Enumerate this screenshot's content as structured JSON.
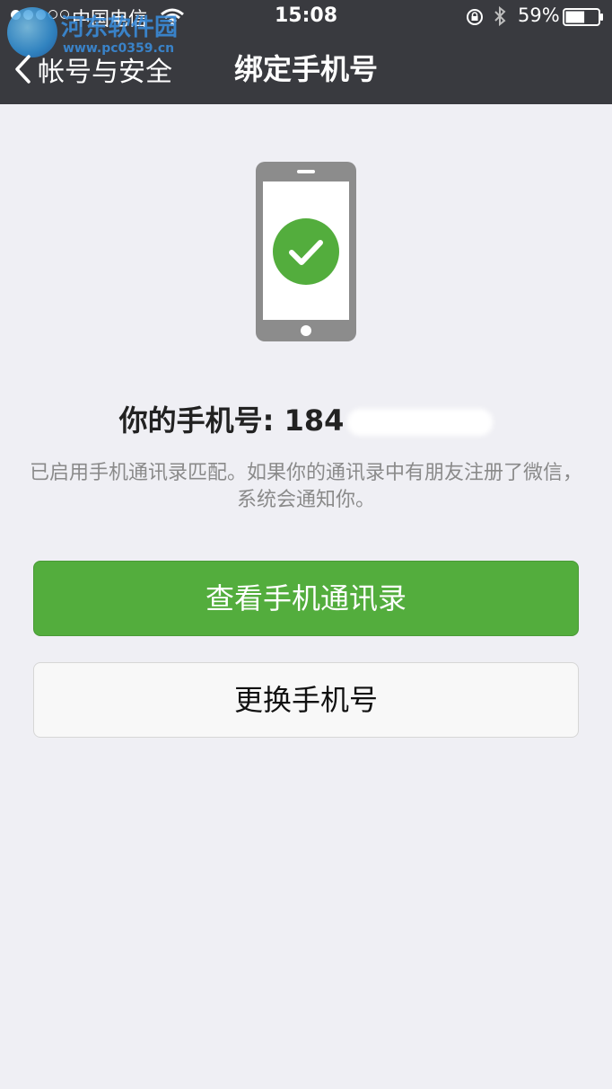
{
  "status_bar": {
    "carrier": "中国电信",
    "time": "15:08",
    "battery_percent": "59%",
    "battery_level": 0.59,
    "icons": [
      "wifi-icon",
      "rotation-lock-icon",
      "bluetooth-icon",
      "battery-icon"
    ]
  },
  "watermark": {
    "text": "河东软件园",
    "url": "www.pc0359.cn"
  },
  "nav": {
    "back_label": "帐号与安全",
    "title": "绑定手机号"
  },
  "content": {
    "phone_label": "你的手机号: 184",
    "description": "已启用手机通讯录匹配。如果你的通讯录中有朋友注册了微信，系统会通知你。",
    "illustration_icon": "phone-check-icon"
  },
  "buttons": {
    "view_contacts": "查看手机通讯录",
    "change_number": "更换手机号"
  },
  "colors": {
    "header_bg": "#393a3f",
    "page_bg": "#efeff4",
    "accent_green": "#53ad3d",
    "phone_gray": "#8c8c8c"
  }
}
